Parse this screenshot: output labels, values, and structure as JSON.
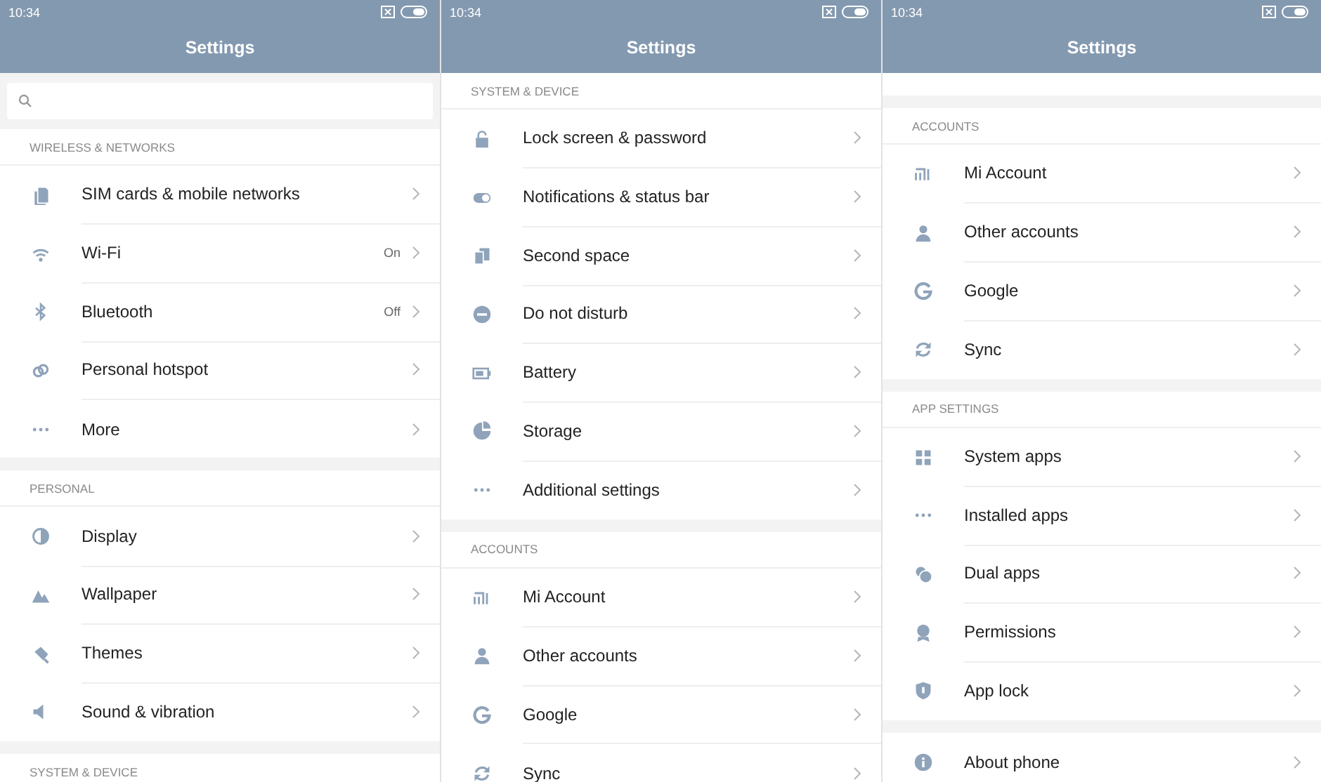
{
  "panels": [
    {
      "time": "10:34",
      "title": "Settings",
      "search": true,
      "sections": [
        {
          "header": "WIRELESS & NETWORKS",
          "items": [
            {
              "label": "SIM cards & mobile networks"
            },
            {
              "label": "Wi-Fi",
              "value": "On"
            },
            {
              "label": "Bluetooth",
              "value": "Off"
            },
            {
              "label": "Personal hotspot"
            },
            {
              "label": "More"
            }
          ]
        },
        {
          "header": "PERSONAL",
          "items": [
            {
              "label": "Display"
            },
            {
              "label": "Wallpaper"
            },
            {
              "label": "Themes"
            },
            {
              "label": "Sound & vibration"
            }
          ]
        },
        {
          "header": "SYSTEM & DEVICE"
        }
      ]
    },
    {
      "time": "10:34",
      "title": "Settings",
      "sections": [
        {
          "header": "SYSTEM & DEVICE",
          "items": [
            {
              "label": "Lock screen & password"
            },
            {
              "label": "Notifications & status bar"
            },
            {
              "label": "Second space"
            },
            {
              "label": "Do not disturb"
            },
            {
              "label": "Battery"
            },
            {
              "label": "Storage"
            },
            {
              "label": "Additional settings"
            }
          ]
        },
        {
          "header": "ACCOUNTS",
          "items": [
            {
              "label": "Mi Account"
            },
            {
              "label": "Other accounts"
            },
            {
              "label": "Google"
            },
            {
              "label": "Sync"
            }
          ]
        }
      ]
    },
    {
      "time": "10:34",
      "title": "Settings",
      "partial_row_top": true,
      "sections": [
        {
          "header": "ACCOUNTS",
          "items": [
            {
              "label": "Mi Account"
            },
            {
              "label": "Other accounts"
            },
            {
              "label": "Google"
            },
            {
              "label": "Sync"
            }
          ]
        },
        {
          "header": "APP SETTINGS",
          "items": [
            {
              "label": "System apps"
            },
            {
              "label": "Installed apps"
            },
            {
              "label": "Dual apps"
            },
            {
              "label": "Permissions"
            },
            {
              "label": "App lock"
            }
          ]
        },
        {
          "items": [
            {
              "label": "About phone"
            }
          ]
        }
      ]
    }
  ]
}
